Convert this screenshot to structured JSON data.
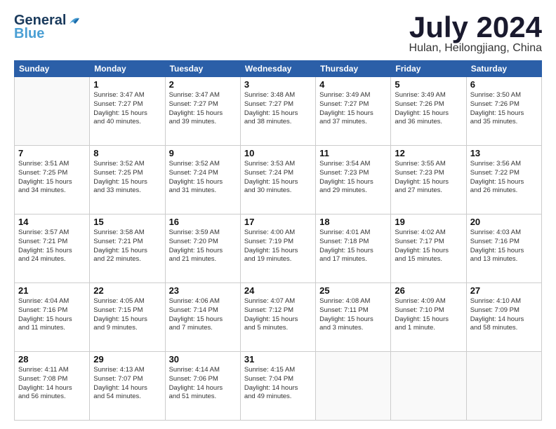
{
  "header": {
    "logo_line1": "General",
    "logo_line2": "Blue",
    "month": "July 2024",
    "location": "Hulan, Heilongjiang, China"
  },
  "columns": [
    "Sunday",
    "Monday",
    "Tuesday",
    "Wednesday",
    "Thursday",
    "Friday",
    "Saturday"
  ],
  "weeks": [
    [
      {
        "day": "",
        "text": ""
      },
      {
        "day": "1",
        "text": "Sunrise: 3:47 AM\nSunset: 7:27 PM\nDaylight: 15 hours\nand 40 minutes."
      },
      {
        "day": "2",
        "text": "Sunrise: 3:47 AM\nSunset: 7:27 PM\nDaylight: 15 hours\nand 39 minutes."
      },
      {
        "day": "3",
        "text": "Sunrise: 3:48 AM\nSunset: 7:27 PM\nDaylight: 15 hours\nand 38 minutes."
      },
      {
        "day": "4",
        "text": "Sunrise: 3:49 AM\nSunset: 7:27 PM\nDaylight: 15 hours\nand 37 minutes."
      },
      {
        "day": "5",
        "text": "Sunrise: 3:49 AM\nSunset: 7:26 PM\nDaylight: 15 hours\nand 36 minutes."
      },
      {
        "day": "6",
        "text": "Sunrise: 3:50 AM\nSunset: 7:26 PM\nDaylight: 15 hours\nand 35 minutes."
      }
    ],
    [
      {
        "day": "7",
        "text": "Sunrise: 3:51 AM\nSunset: 7:25 PM\nDaylight: 15 hours\nand 34 minutes."
      },
      {
        "day": "8",
        "text": "Sunrise: 3:52 AM\nSunset: 7:25 PM\nDaylight: 15 hours\nand 33 minutes."
      },
      {
        "day": "9",
        "text": "Sunrise: 3:52 AM\nSunset: 7:24 PM\nDaylight: 15 hours\nand 31 minutes."
      },
      {
        "day": "10",
        "text": "Sunrise: 3:53 AM\nSunset: 7:24 PM\nDaylight: 15 hours\nand 30 minutes."
      },
      {
        "day": "11",
        "text": "Sunrise: 3:54 AM\nSunset: 7:23 PM\nDaylight: 15 hours\nand 29 minutes."
      },
      {
        "day": "12",
        "text": "Sunrise: 3:55 AM\nSunset: 7:23 PM\nDaylight: 15 hours\nand 27 minutes."
      },
      {
        "day": "13",
        "text": "Sunrise: 3:56 AM\nSunset: 7:22 PM\nDaylight: 15 hours\nand 26 minutes."
      }
    ],
    [
      {
        "day": "14",
        "text": "Sunrise: 3:57 AM\nSunset: 7:21 PM\nDaylight: 15 hours\nand 24 minutes."
      },
      {
        "day": "15",
        "text": "Sunrise: 3:58 AM\nSunset: 7:21 PM\nDaylight: 15 hours\nand 22 minutes."
      },
      {
        "day": "16",
        "text": "Sunrise: 3:59 AM\nSunset: 7:20 PM\nDaylight: 15 hours\nand 21 minutes."
      },
      {
        "day": "17",
        "text": "Sunrise: 4:00 AM\nSunset: 7:19 PM\nDaylight: 15 hours\nand 19 minutes."
      },
      {
        "day": "18",
        "text": "Sunrise: 4:01 AM\nSunset: 7:18 PM\nDaylight: 15 hours\nand 17 minutes."
      },
      {
        "day": "19",
        "text": "Sunrise: 4:02 AM\nSunset: 7:17 PM\nDaylight: 15 hours\nand 15 minutes."
      },
      {
        "day": "20",
        "text": "Sunrise: 4:03 AM\nSunset: 7:16 PM\nDaylight: 15 hours\nand 13 minutes."
      }
    ],
    [
      {
        "day": "21",
        "text": "Sunrise: 4:04 AM\nSunset: 7:16 PM\nDaylight: 15 hours\nand 11 minutes."
      },
      {
        "day": "22",
        "text": "Sunrise: 4:05 AM\nSunset: 7:15 PM\nDaylight: 15 hours\nand 9 minutes."
      },
      {
        "day": "23",
        "text": "Sunrise: 4:06 AM\nSunset: 7:14 PM\nDaylight: 15 hours\nand 7 minutes."
      },
      {
        "day": "24",
        "text": "Sunrise: 4:07 AM\nSunset: 7:12 PM\nDaylight: 15 hours\nand 5 minutes."
      },
      {
        "day": "25",
        "text": "Sunrise: 4:08 AM\nSunset: 7:11 PM\nDaylight: 15 hours\nand 3 minutes."
      },
      {
        "day": "26",
        "text": "Sunrise: 4:09 AM\nSunset: 7:10 PM\nDaylight: 15 hours\nand 1 minute."
      },
      {
        "day": "27",
        "text": "Sunrise: 4:10 AM\nSunset: 7:09 PM\nDaylight: 14 hours\nand 58 minutes."
      }
    ],
    [
      {
        "day": "28",
        "text": "Sunrise: 4:11 AM\nSunset: 7:08 PM\nDaylight: 14 hours\nand 56 minutes."
      },
      {
        "day": "29",
        "text": "Sunrise: 4:13 AM\nSunset: 7:07 PM\nDaylight: 14 hours\nand 54 minutes."
      },
      {
        "day": "30",
        "text": "Sunrise: 4:14 AM\nSunset: 7:06 PM\nDaylight: 14 hours\nand 51 minutes."
      },
      {
        "day": "31",
        "text": "Sunrise: 4:15 AM\nSunset: 7:04 PM\nDaylight: 14 hours\nand 49 minutes."
      },
      {
        "day": "",
        "text": ""
      },
      {
        "day": "",
        "text": ""
      },
      {
        "day": "",
        "text": ""
      }
    ]
  ]
}
